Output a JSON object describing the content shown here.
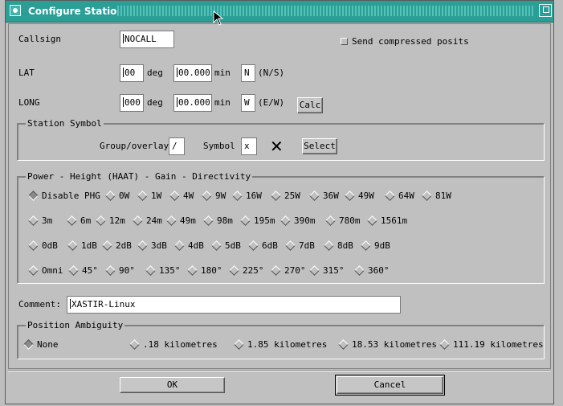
{
  "window": {
    "title": "Configure Station"
  },
  "callsign": {
    "label": "Callsign",
    "value": "NOCALL"
  },
  "compressed": {
    "label": "Send compressed posits",
    "checked": false
  },
  "lat": {
    "label": "LAT",
    "deg_value": "00",
    "deg_unit": "deg",
    "min_value": "00.000",
    "min_unit": "min",
    "hemi_value": "N",
    "hemi_hint": "(N/S)"
  },
  "long": {
    "label": "LONG",
    "deg_value": "000",
    "deg_unit": "deg",
    "min_value": "00.000",
    "min_unit": "min",
    "hemi_value": "W",
    "hemi_hint": "(E/W)",
    "calc_label": "Calc"
  },
  "symbol": {
    "group_title": "Station Symbol",
    "overlay_label": "Group/overlay",
    "overlay_value": "/",
    "symbol_label": "Symbol",
    "symbol_value": "x",
    "preview": "✕",
    "select_label": "Select"
  },
  "phg": {
    "group_title": "Power - Height (HAAT) - Gain - Directivity",
    "power": [
      "Disable PHG",
      "0W",
      "1W",
      "4W",
      "9W",
      "16W",
      "25W",
      "36W",
      "49W",
      "64W",
      "81W"
    ],
    "height": [
      "3m",
      "6m",
      "12m",
      "24m",
      "49m",
      "98m",
      "195m",
      "390m",
      "780m",
      "1561m"
    ],
    "gain": [
      "0dB",
      "1dB",
      "2dB",
      "3dB",
      "4dB",
      "5dB",
      "6dB",
      "7dB",
      "8dB",
      "9dB"
    ],
    "directivity": [
      "Omni",
      "45°",
      "90°",
      "135°",
      "180°",
      "225°",
      "270°",
      "315°",
      "360°"
    ],
    "selected_power": "Disable PHG"
  },
  "comment": {
    "label": "Comment:",
    "value": "XASTIR-Linux"
  },
  "ambiguity": {
    "group_title": "Position Ambiguity",
    "options": [
      "None",
      ".18 kilometres",
      "1.85 kilometres",
      "18.53 kilometres",
      "111.19 kilometres"
    ],
    "selected": "None"
  },
  "buttons": {
    "ok": "OK",
    "cancel": "Cancel"
  },
  "colors": {
    "titlebar": "#2b9e96",
    "background": "#c0c0c0"
  }
}
